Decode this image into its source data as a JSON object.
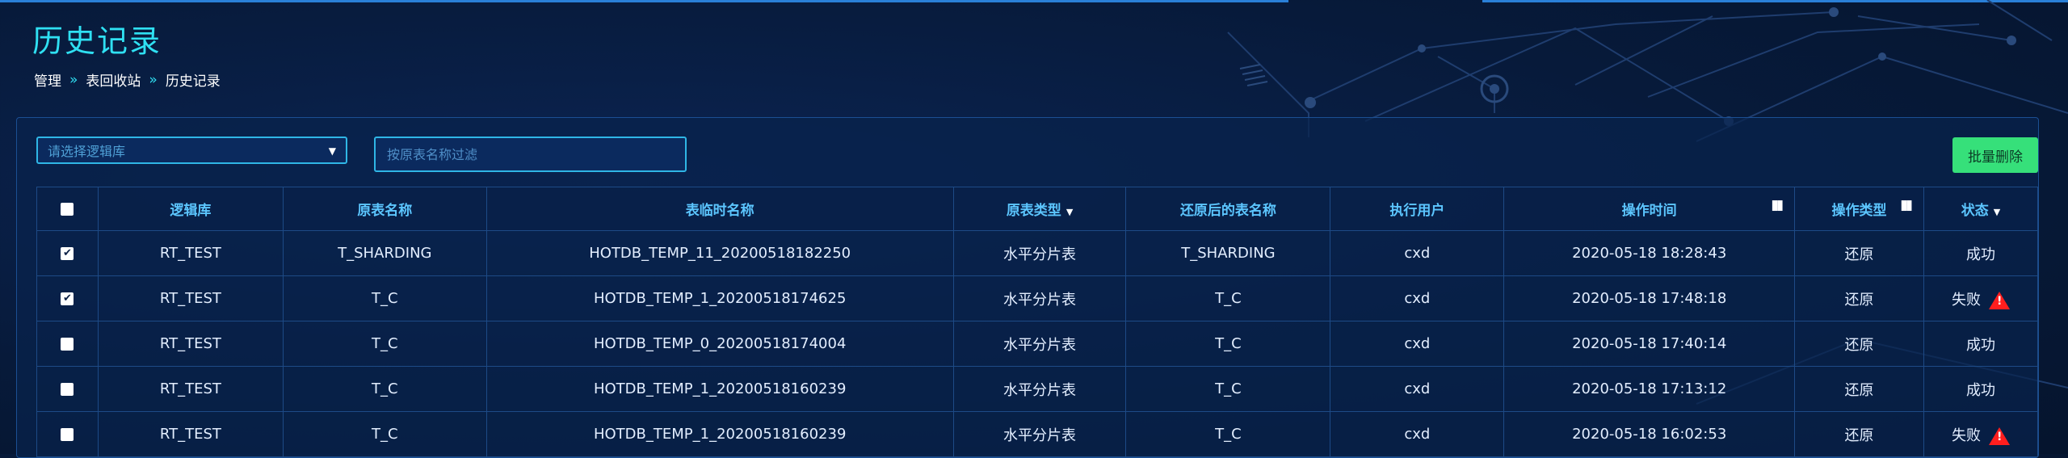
{
  "page": {
    "title": "历史记录",
    "breadcrumb": [
      "管理",
      "表回收站",
      "历史记录"
    ]
  },
  "toolbar": {
    "db_select_placeholder": "请选择逻辑库",
    "filter_placeholder": "按原表名称过滤",
    "batch_delete_label": "批量删除"
  },
  "table": {
    "columns": [
      "逻辑库",
      "原表名称",
      "表临时名称",
      "原表类型",
      "还原后的表名称",
      "执行用户",
      "操作时间",
      "操作类型",
      "状态"
    ],
    "rows": [
      {
        "checked": true,
        "db": "RT_TEST",
        "orig": "T_SHARDING",
        "temp": "HOTDB_TEMP_11_20200518182250",
        "type": "水平分片表",
        "restored": "T_SHARDING",
        "user": "cxd",
        "time": "2020-05-18 18:28:43",
        "op": "还原",
        "status": "成功",
        "warn": false
      },
      {
        "checked": true,
        "db": "RT_TEST",
        "orig": "T_C",
        "temp": "HOTDB_TEMP_1_20200518174625",
        "type": "水平分片表",
        "restored": "T_C",
        "user": "cxd",
        "time": "2020-05-18 17:48:18",
        "op": "还原",
        "status": "失败",
        "warn": true
      },
      {
        "checked": false,
        "db": "RT_TEST",
        "orig": "T_C",
        "temp": "HOTDB_TEMP_0_20200518174004",
        "type": "水平分片表",
        "restored": "T_C",
        "user": "cxd",
        "time": "2020-05-18 17:40:14",
        "op": "还原",
        "status": "成功",
        "warn": false
      },
      {
        "checked": false,
        "db": "RT_TEST",
        "orig": "T_C",
        "temp": "HOTDB_TEMP_1_20200518160239",
        "type": "水平分片表",
        "restored": "T_C",
        "user": "cxd",
        "time": "2020-05-18 17:13:12",
        "op": "还原",
        "status": "成功",
        "warn": false
      },
      {
        "checked": false,
        "db": "RT_TEST",
        "orig": "T_C",
        "temp": "HOTDB_TEMP_1_20200518160239",
        "type": "水平分片表",
        "restored": "T_C",
        "user": "cxd",
        "time": "2020-05-18 16:02:53",
        "op": "还原",
        "status": "失败",
        "warn": true
      }
    ]
  },
  "colors": {
    "accent": "#2fe0f2",
    "header_text": "#5cc6ff",
    "batch_delete_bg": "#36e07a",
    "warn": "#ff1e1e"
  },
  "icons": {
    "checkbox_checked": "✔",
    "sort": "▼",
    "filter": "binoculars-icon",
    "warn": "warning-triangle-icon",
    "breadcrumb_separator": "»"
  }
}
